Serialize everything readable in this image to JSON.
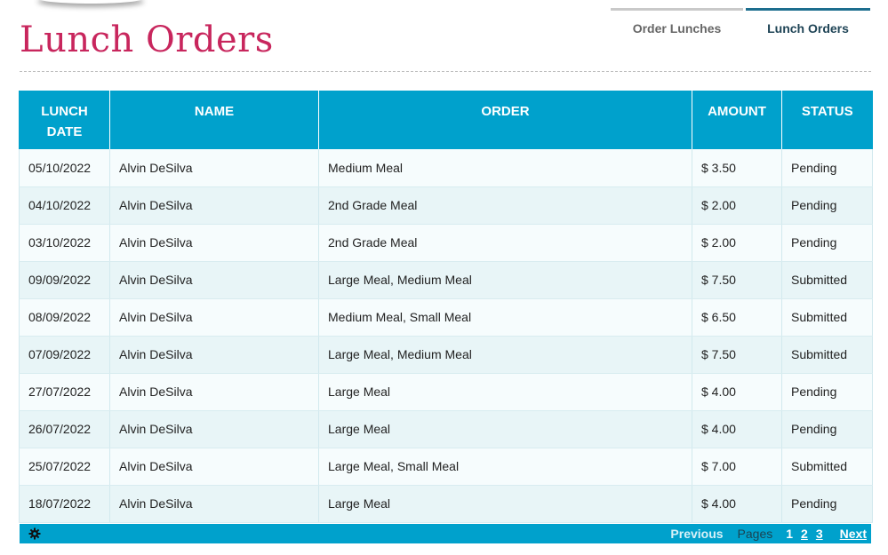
{
  "page": {
    "title": "Lunch Orders"
  },
  "tabs": [
    {
      "label": "Order Lunches"
    },
    {
      "label": "Lunch Orders"
    }
  ],
  "table": {
    "headers": [
      "LUNCH DATE",
      "NAME",
      "ORDER",
      "AMOUNT",
      "STATUS"
    ],
    "rows": [
      [
        "05/10/2022",
        "Alvin DeSilva",
        "Medium Meal",
        "$ 3.50",
        "Pending"
      ],
      [
        "04/10/2022",
        "Alvin DeSilva",
        "2nd Grade Meal",
        "$ 2.00",
        "Pending"
      ],
      [
        "03/10/2022",
        "Alvin DeSilva",
        "2nd Grade Meal",
        "$ 2.00",
        "Pending"
      ],
      [
        "09/09/2022",
        "Alvin DeSilva",
        "Large Meal, Medium Meal",
        "$ 7.50",
        "Submitted"
      ],
      [
        "08/09/2022",
        "Alvin DeSilva",
        "Medium Meal, Small Meal",
        "$ 6.50",
        "Submitted"
      ],
      [
        "07/09/2022",
        "Alvin DeSilva",
        "Large Meal, Medium Meal",
        "$ 7.50",
        "Submitted"
      ],
      [
        "27/07/2022",
        "Alvin DeSilva",
        "Large Meal",
        "$ 4.00",
        "Pending"
      ],
      [
        "26/07/2022",
        "Alvin DeSilva",
        "Large Meal",
        "$ 4.00",
        "Pending"
      ],
      [
        "25/07/2022",
        "Alvin DeSilva",
        "Large Meal, Small Meal",
        "$ 7.00",
        "Submitted"
      ],
      [
        "18/07/2022",
        "Alvin DeSilva",
        "Large Meal",
        "$ 4.00",
        "Pending"
      ]
    ]
  },
  "pager": {
    "gear_icon": "gear-icon",
    "previous_label": "Previous",
    "pages_label": "Pages",
    "pages": [
      "1",
      "2",
      "3"
    ],
    "next_label": "Next"
  },
  "colors": {
    "accent": "#00a1cc",
    "title": "#c8265d",
    "row_odd": "#f6fcfd",
    "row_even": "#e8f5f7"
  }
}
